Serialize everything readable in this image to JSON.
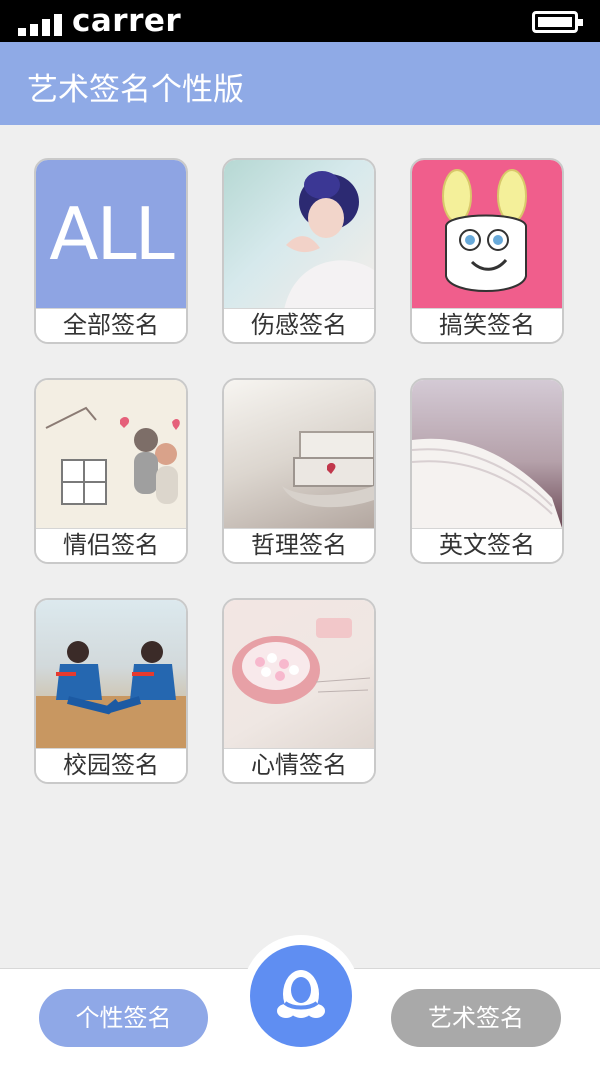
{
  "status_bar": {
    "carrier": "carrer",
    "icons": [
      "signal-icon",
      "battery-icon"
    ]
  },
  "app_bar": {
    "title": "艺术签名个性版",
    "color": "#8faae6"
  },
  "categories": [
    {
      "label": "全部签名",
      "image_text": "ALL",
      "image": "all-icon"
    },
    {
      "label": "伤感签名",
      "image": "sad-girl-photo"
    },
    {
      "label": "搞笑签名",
      "image": "funny-cartoon-deer"
    },
    {
      "label": "情侣签名",
      "image": "couple-illustration"
    },
    {
      "label": "哲理签名",
      "image": "stacked-books-photo"
    },
    {
      "label": "英文签名",
      "image": "open-book-photo"
    },
    {
      "label": "校园签名",
      "image": "campus-students-photo"
    },
    {
      "label": "心情签名",
      "image": "candy-jar-photo"
    }
  ],
  "bottom_bar": {
    "left_button": "个性签名",
    "right_button": "艺术签名",
    "center_icon": "penguin-icon",
    "accent": "#5f8ef2"
  }
}
